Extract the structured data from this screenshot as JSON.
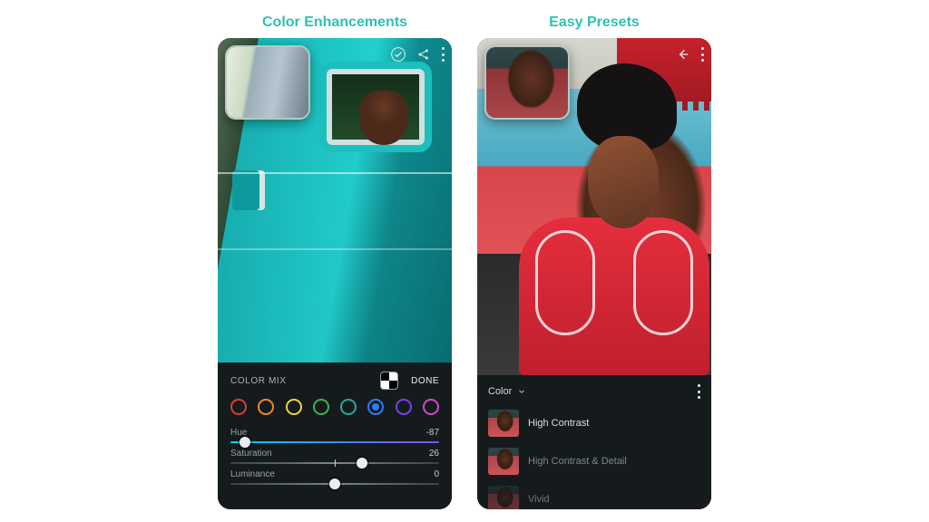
{
  "phones": [
    {
      "title": "Color Enhancements",
      "panel": {
        "label": "COLOR MIX",
        "done": "DONE",
        "colors": [
          {
            "hex": "#e03a2f",
            "name": "red"
          },
          {
            "hex": "#ec8a2a",
            "name": "orange"
          },
          {
            "hex": "#f3d33b",
            "name": "yellow"
          },
          {
            "hex": "#3fb24f",
            "name": "green"
          },
          {
            "hex": "#2aa6a0",
            "name": "teal"
          },
          {
            "hex": "#2b7bff",
            "name": "blue",
            "selected": true
          },
          {
            "hex": "#7a3ff0",
            "name": "purple"
          },
          {
            "hex": "#d648c7",
            "name": "magenta"
          }
        ],
        "sliders": [
          {
            "key": "hue",
            "label": "Hue",
            "value": -87,
            "pos_pct": 7,
            "track": "hue"
          },
          {
            "key": "saturation",
            "label": "Saturation",
            "value": 26,
            "pos_pct": 63,
            "track": "plain"
          },
          {
            "key": "luminance",
            "label": "Luminance",
            "value": 0,
            "pos_pct": 50,
            "track": "plain"
          }
        ]
      }
    },
    {
      "title": "Easy Presets",
      "panel": {
        "category": "Color",
        "presets": [
          {
            "name": "High Contrast"
          },
          {
            "name": "High Contrast & Detail"
          },
          {
            "name": "Vivid"
          }
        ]
      }
    }
  ]
}
